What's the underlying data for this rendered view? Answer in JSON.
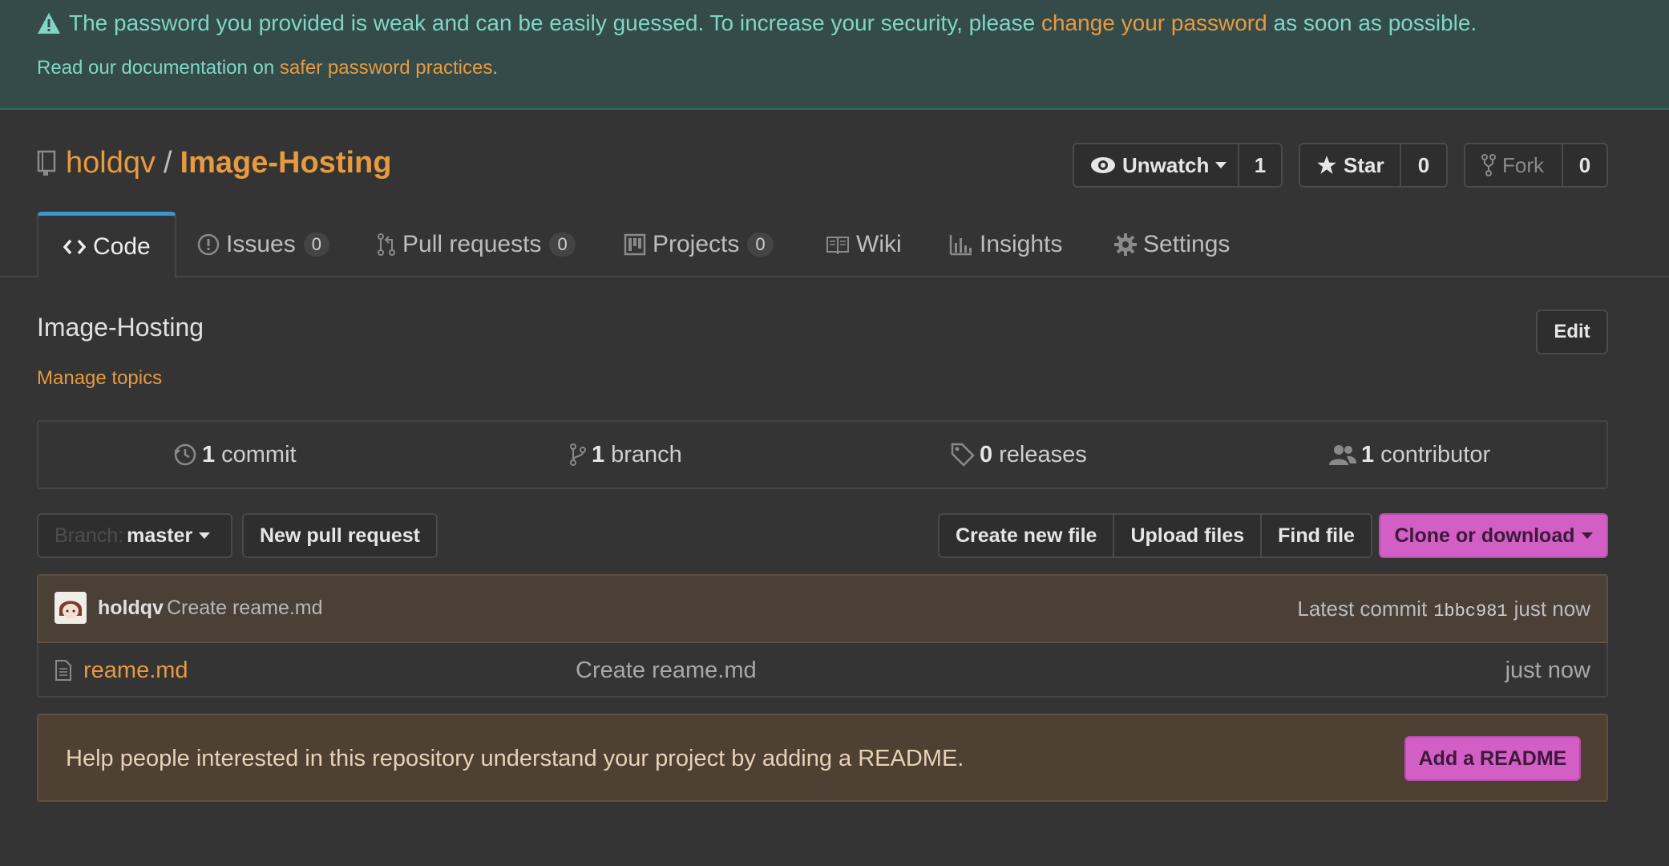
{
  "banner": {
    "line1_before": "The password you provided is weak and can be easily guessed. To increase your security, please ",
    "line1_link": "change your password",
    "line1_after": " as soon as possible.",
    "line2_before": "Read our documentation on ",
    "line2_link": "safer password practices",
    "line2_after": "."
  },
  "repo": {
    "owner": "holdqv",
    "separator": "/",
    "name": "Image-Hosting"
  },
  "actions": {
    "watch_label": "Unwatch",
    "watch_count": "1",
    "star_label": "Star",
    "star_count": "0",
    "fork_label": "Fork",
    "fork_count": "0"
  },
  "tabs": [
    {
      "label": "Code"
    },
    {
      "label": "Issues",
      "count": "0"
    },
    {
      "label": "Pull requests",
      "count": "0"
    },
    {
      "label": "Projects",
      "count": "0"
    },
    {
      "label": "Wiki"
    },
    {
      "label": "Insights"
    },
    {
      "label": "Settings"
    }
  ],
  "description": "Image-Hosting",
  "edit_label": "Edit",
  "topics_link": "Manage topics",
  "summary": {
    "commits_num": "1",
    "commits_label": "commit",
    "branches_num": "1",
    "branches_label": "branch",
    "releases_num": "0",
    "releases_label": "releases",
    "contributors_num": "1",
    "contributors_label": "contributor"
  },
  "toolbar": {
    "branch_label": "Branch:",
    "branch_value": "master",
    "new_pr": "New pull request",
    "create_file": "Create new file",
    "upload_files": "Upload files",
    "find_file": "Find file",
    "clone": "Clone or download"
  },
  "commit": {
    "author": "holdqv",
    "message": "Create reame.md",
    "latest_label": "Latest commit",
    "sha": "1bbc981",
    "age": "just now"
  },
  "files": [
    {
      "name": "reame.md",
      "message": "Create reame.md",
      "age": "just now"
    }
  ],
  "readme": {
    "text": "Help people interested in this repository understand your project by adding a README.",
    "button": "Add a README"
  },
  "colors": {
    "accent_orange": "#e79a3f",
    "banner_bg": "#344b4a",
    "banner_text": "#7fd6c4",
    "primary_button": "#d35ec6",
    "active_tab": "#3a97d4"
  }
}
